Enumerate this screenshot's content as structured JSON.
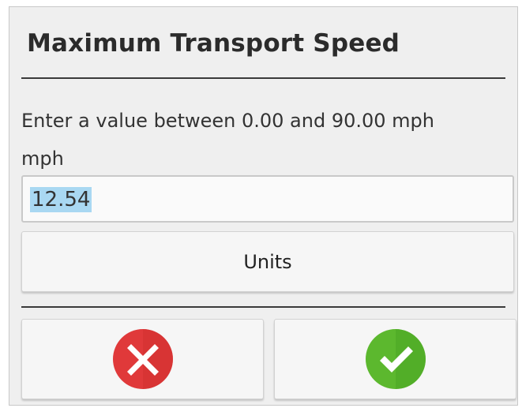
{
  "dialog": {
    "title": "Maximum Transport Speed",
    "prompt": "Enter a value between 0.00 and 90.00 mph",
    "unit_label": "mph",
    "input_value": "12.54",
    "units_button_label": "Units",
    "cancel_icon": "cancel-x-icon",
    "confirm_icon": "confirm-check-icon"
  },
  "colors": {
    "cancel_red": "#e0393a",
    "confirm_green": "#5cb82e",
    "selection_blue": "#a9d8f2"
  }
}
